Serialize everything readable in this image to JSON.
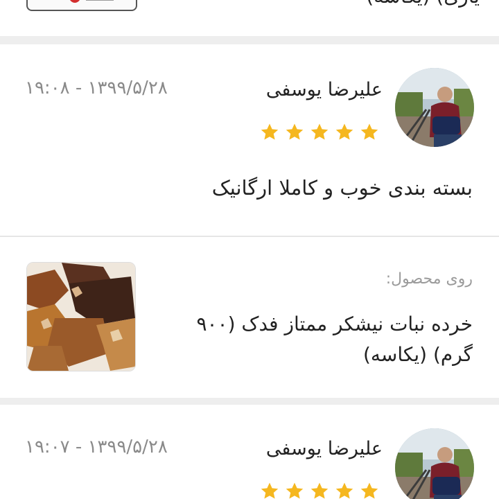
{
  "top_partial": {
    "text_fragment": "یاری) (یکاسه)"
  },
  "reviews": [
    {
      "user_name": "علیرضا یوسفی",
      "date": "۱۳۹۹/۵/۲۸ - ۱۹:۰۸",
      "rating": 5,
      "comment": "بسته بندی خوب و کاملا ارگانیک",
      "avatar": "user-avatar-photo"
    },
    {
      "user_name": "علیرضا یوسفی",
      "date": "۱۳۹۹/۵/۲۸ - ۱۹:۰۷",
      "rating": 5,
      "avatar": "user-avatar-photo"
    }
  ],
  "product": {
    "label": "روی محصول:",
    "name_line1": "خرده نبات نیشکر ممتاز فدک (۹۰۰",
    "name_line2": "گرم) (یکاسه)",
    "thumbnail": "rock-sugar-photo"
  },
  "colors": {
    "star": "#f5b71f",
    "background": "#eeeeee",
    "card": "#ffffff",
    "muted_text": "#8a8a8a"
  }
}
